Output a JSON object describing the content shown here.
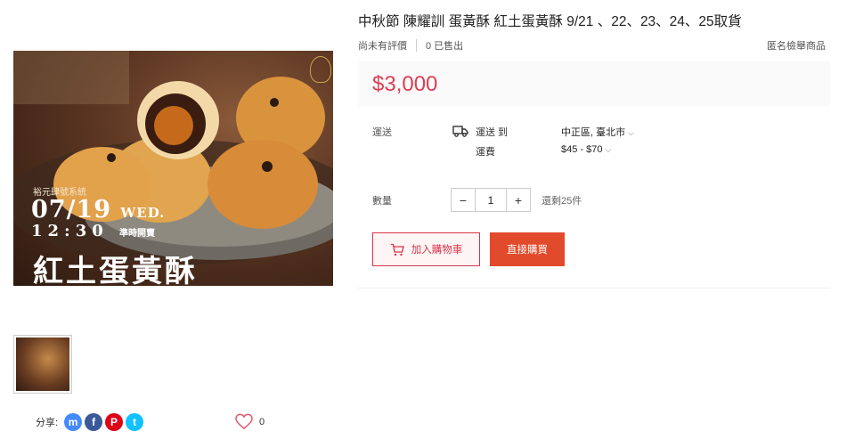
{
  "image": {
    "brand": "裕元肆號系統",
    "date": "07/19",
    "weekday": "WED.",
    "time": "12:30",
    "time_suffix": "準時開賣",
    "name": "紅土蛋黃酥"
  },
  "share": {
    "label": "分享:"
  },
  "social": {
    "messenger": "m",
    "facebook": "f",
    "pinterest": "P",
    "twitter": "t"
  },
  "likes": {
    "count": "0"
  },
  "product": {
    "title": "中秋節 陳耀訓 蛋黃酥 紅土蛋黃酥 9/21 、22、23、24、25取貨",
    "rating": "尚未有評價",
    "sold": "0 已售出",
    "report": "匿名檢舉商品",
    "price": "$3,000"
  },
  "shipping": {
    "label": "運送",
    "to_label": "運送 到",
    "fee_label": "運費",
    "location": "中正區, 臺北市",
    "fee_range": "$45 - $70"
  },
  "quantity": {
    "label": "數量",
    "minus": "−",
    "value": "1",
    "plus": "+",
    "stock": "還剩25件"
  },
  "actions": {
    "add_to_cart": "加入購物車",
    "buy_now": "直接購買"
  },
  "colors": {
    "accent": "#e24a2c",
    "price": "#d0011b",
    "messenger": "#448aff",
    "facebook": "#3b5999",
    "pinterest": "#de0217",
    "twitter": "#10c2ff"
  }
}
